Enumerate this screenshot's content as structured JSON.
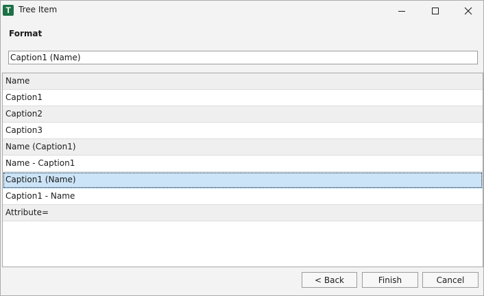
{
  "window": {
    "title": "Tree Item",
    "icon_letter": "T",
    "icon_color": "#1e7145",
    "controls": [
      "minimize-icon",
      "maximize-icon",
      "close-icon"
    ]
  },
  "format": {
    "label": "Format",
    "value": "Caption1 (Name)"
  },
  "list": {
    "items": [
      "Name",
      "Caption1",
      "Caption2",
      "Caption3",
      "Name (Caption1)",
      "Name - Caption1",
      "Caption1 (Name)",
      "Caption1 - Name",
      "Attribute="
    ],
    "selected": "Caption1 (Name)",
    "selection_color": "#cce4f7"
  },
  "buttons": {
    "back": "< Back",
    "finish": "Finish",
    "cancel": "Cancel"
  }
}
